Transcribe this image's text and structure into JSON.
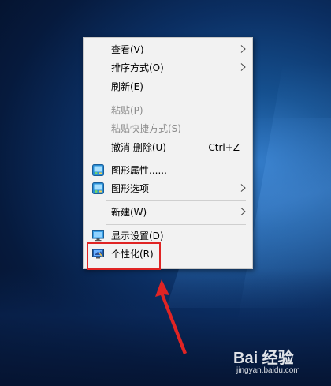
{
  "context_menu": {
    "items": [
      {
        "label": "查看(V)",
        "shortcut": "",
        "submenu": true,
        "disabled": false,
        "icon": ""
      },
      {
        "label": "排序方式(O)",
        "shortcut": "",
        "submenu": true,
        "disabled": false,
        "icon": ""
      },
      {
        "label": "刷新(E)",
        "shortcut": "",
        "submenu": false,
        "disabled": false,
        "icon": ""
      },
      {
        "label": "粘贴(P)",
        "shortcut": "",
        "submenu": false,
        "disabled": true,
        "icon": ""
      },
      {
        "label": "粘贴快捷方式(S)",
        "shortcut": "",
        "submenu": false,
        "disabled": true,
        "icon": ""
      },
      {
        "label": "撤消 删除(U)",
        "shortcut": "Ctrl+Z",
        "submenu": false,
        "disabled": false,
        "icon": ""
      },
      {
        "label": "图形属性......",
        "shortcut": "",
        "submenu": false,
        "disabled": false,
        "icon": "intel-graphics-icon"
      },
      {
        "label": "图形选项",
        "shortcut": "",
        "submenu": true,
        "disabled": false,
        "icon": "intel-graphics-icon"
      },
      {
        "label": "新建(W)",
        "shortcut": "",
        "submenu": true,
        "disabled": false,
        "icon": ""
      },
      {
        "label": "显示设置(D)",
        "shortcut": "",
        "submenu": false,
        "disabled": false,
        "icon": "display-settings-icon"
      },
      {
        "label": "个性化(R)",
        "shortcut": "",
        "submenu": false,
        "disabled": false,
        "icon": "personalize-icon"
      }
    ]
  },
  "annotation": {
    "highlight_color": "#e02424",
    "highlighted_item": "个性化(R)"
  },
  "watermark": {
    "brand": "Bai 经验",
    "url": "jingyan.baidu.com"
  }
}
